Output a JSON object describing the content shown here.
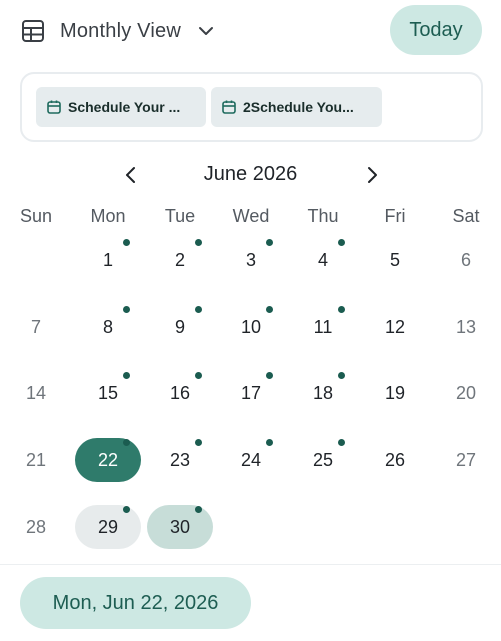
{
  "header": {
    "view_label": "Monthly View",
    "today_label": "Today"
  },
  "events": [
    {
      "title": "Schedule Your ..."
    },
    {
      "title": "2Schedule You..."
    }
  ],
  "calendar": {
    "month_title": "June 2026",
    "weekdays": [
      "Sun",
      "Mon",
      "Tue",
      "Wed",
      "Thu",
      "Fri",
      "Sat"
    ],
    "weeks": [
      [
        {
          "day": ""
        },
        {
          "day": "1",
          "dot": true
        },
        {
          "day": "2",
          "dot": true
        },
        {
          "day": "3",
          "dot": true
        },
        {
          "day": "4",
          "dot": true
        },
        {
          "day": "5"
        },
        {
          "day": "6"
        }
      ],
      [
        {
          "day": "7"
        },
        {
          "day": "8",
          "dot": true
        },
        {
          "day": "9",
          "dot": true
        },
        {
          "day": "10",
          "dot": true
        },
        {
          "day": "11",
          "dot": true
        },
        {
          "day": "12"
        },
        {
          "day": "13"
        }
      ],
      [
        {
          "day": "14"
        },
        {
          "day": "15",
          "dot": true
        },
        {
          "day": "16",
          "dot": true
        },
        {
          "day": "17",
          "dot": true
        },
        {
          "day": "18",
          "dot": true
        },
        {
          "day": "19"
        },
        {
          "day": "20"
        }
      ],
      [
        {
          "day": "21"
        },
        {
          "day": "22",
          "dot": true,
          "state": "selected"
        },
        {
          "day": "23",
          "dot": true
        },
        {
          "day": "24",
          "dot": true
        },
        {
          "day": "25",
          "dot": true
        },
        {
          "day": "26"
        },
        {
          "day": "27"
        }
      ],
      [
        {
          "day": "28"
        },
        {
          "day": "29",
          "dot": true,
          "state": "range"
        },
        {
          "day": "30",
          "dot": true,
          "state": "rangeend"
        },
        {
          "day": ""
        },
        {
          "day": ""
        },
        {
          "day": ""
        },
        {
          "day": ""
        }
      ]
    ]
  },
  "selected_date_label": "Mon, Jun 22, 2026",
  "colors": {
    "accent": "#2f7b6b",
    "accent_soft": "#cde8e3",
    "event_dot": "#1b5c50"
  }
}
